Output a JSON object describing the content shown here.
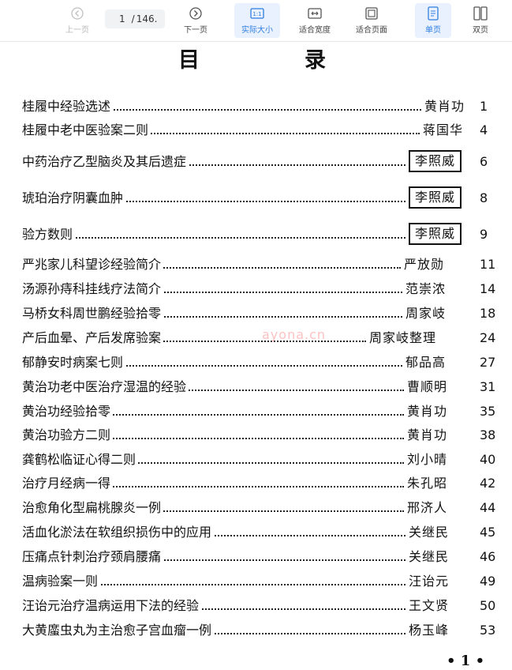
{
  "toolbar": {
    "prev_label": "上一页",
    "page_current": "1",
    "page_sep": "/",
    "page_total": "146.",
    "next_label": "下一页",
    "actual_size_label": "实际大小",
    "fit_width_label": "适合宽度",
    "fit_page_label": "适合页面",
    "single_page_label": "单页",
    "double_page_label": "双页",
    "accent": "#2f7de1"
  },
  "document": {
    "title_left": "目",
    "title_right": "录",
    "entries": [
      {
        "title": "桂履中经验选述",
        "author": "黄肖功",
        "page": "1"
      },
      {
        "title": "桂履中老中医验案二则",
        "author": "蒋国华",
        "page": "4"
      },
      {
        "title": "中药治疗乙型脑炎及其后遗症",
        "author": "李照威",
        "page": "6"
      },
      {
        "title": "琥珀治疗阴囊血肿",
        "author": "李照威",
        "page": "8"
      },
      {
        "title": "验方数则",
        "author": "李照威",
        "page": "9"
      },
      {
        "title": "严兆家儿科望诊经验简介",
        "author": "严放勋",
        "page": "11"
      },
      {
        "title": "汤源孙痔科挂线疗法简介",
        "author": "范崇浓",
        "page": "14"
      },
      {
        "title": "马桥女科周世鹏经验拾零",
        "author": "周家岐",
        "page": "18"
      },
      {
        "title": "产后血晕、产后发席验案",
        "author": "周家岐整理",
        "page": "24"
      },
      {
        "title": "郁静安时病案七则",
        "author": "郁品高",
        "page": "27"
      },
      {
        "title": "黄治功老中医治疗湿温的经验",
        "author": "曹顺明",
        "page": "31"
      },
      {
        "title": "黄治功经验拾零",
        "author": "黄肖功",
        "page": "35"
      },
      {
        "title": "黄治功验方二则",
        "author": "黄肖功",
        "page": "38"
      },
      {
        "title": "龚鹤松临证心得二则",
        "author": "刘小晴",
        "page": "40"
      },
      {
        "title": "治疗月经病一得",
        "author": "朱孔昭",
        "page": "42"
      },
      {
        "title": "治愈角化型扁桃腺炎一例",
        "author": "邢济人",
        "page": "44"
      },
      {
        "title": "活血化淤法在软组织损伤中的应用",
        "author": "关继民",
        "page": "45"
      },
      {
        "title": "压痛点针刺治疗颈肩腰痛",
        "author": "关继民",
        "page": "46"
      },
      {
        "title": "温病验案一则",
        "author": "汪诒元",
        "page": "49"
      },
      {
        "title": "汪诒元治疗温病运用下法的经验",
        "author": "王文贤",
        "page": "50"
      },
      {
        "title": "大黄䗪虫丸为主治愈子宫血瘤一例",
        "author": "杨玉峰",
        "page": "53"
      }
    ],
    "watermark": "ayona.cn",
    "footer_page": "• 1 •"
  }
}
